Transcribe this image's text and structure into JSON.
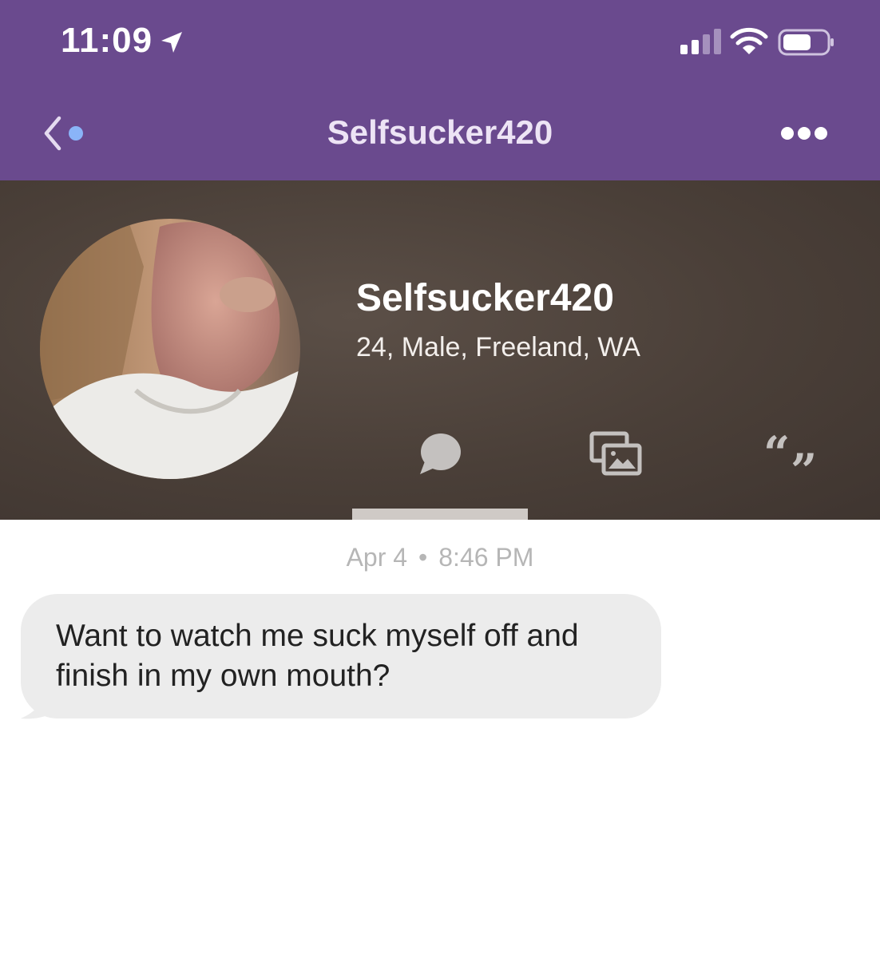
{
  "status_bar": {
    "time": "11:09",
    "icons": [
      "location-arrow-icon",
      "cellular-signal-icon",
      "wifi-icon",
      "battery-icon"
    ]
  },
  "nav": {
    "title": "Selfsucker420",
    "back_icon": "chevron-left-icon",
    "more_icon": "more-icon"
  },
  "profile": {
    "name": "Selfsucker420",
    "meta": "24, Male, Freeland, WA"
  },
  "tabs": [
    {
      "icon": "chat-bubble-icon",
      "selected": true
    },
    {
      "icon": "photos-icon",
      "selected": false
    },
    {
      "icon": "quote-icon",
      "selected": false
    }
  ],
  "conversation": {
    "date": "Apr 4",
    "separator": "•",
    "time": "8:46 PM",
    "messages": [
      {
        "line1": "Want to watch me suck myself off and",
        "line2": "finish in my own mouth?"
      }
    ]
  },
  "colors": {
    "header": "#6a4a8e",
    "profile_bg": "#4a3f38",
    "bubble": "#ececec",
    "unread_dot": "#8ab4f8"
  }
}
